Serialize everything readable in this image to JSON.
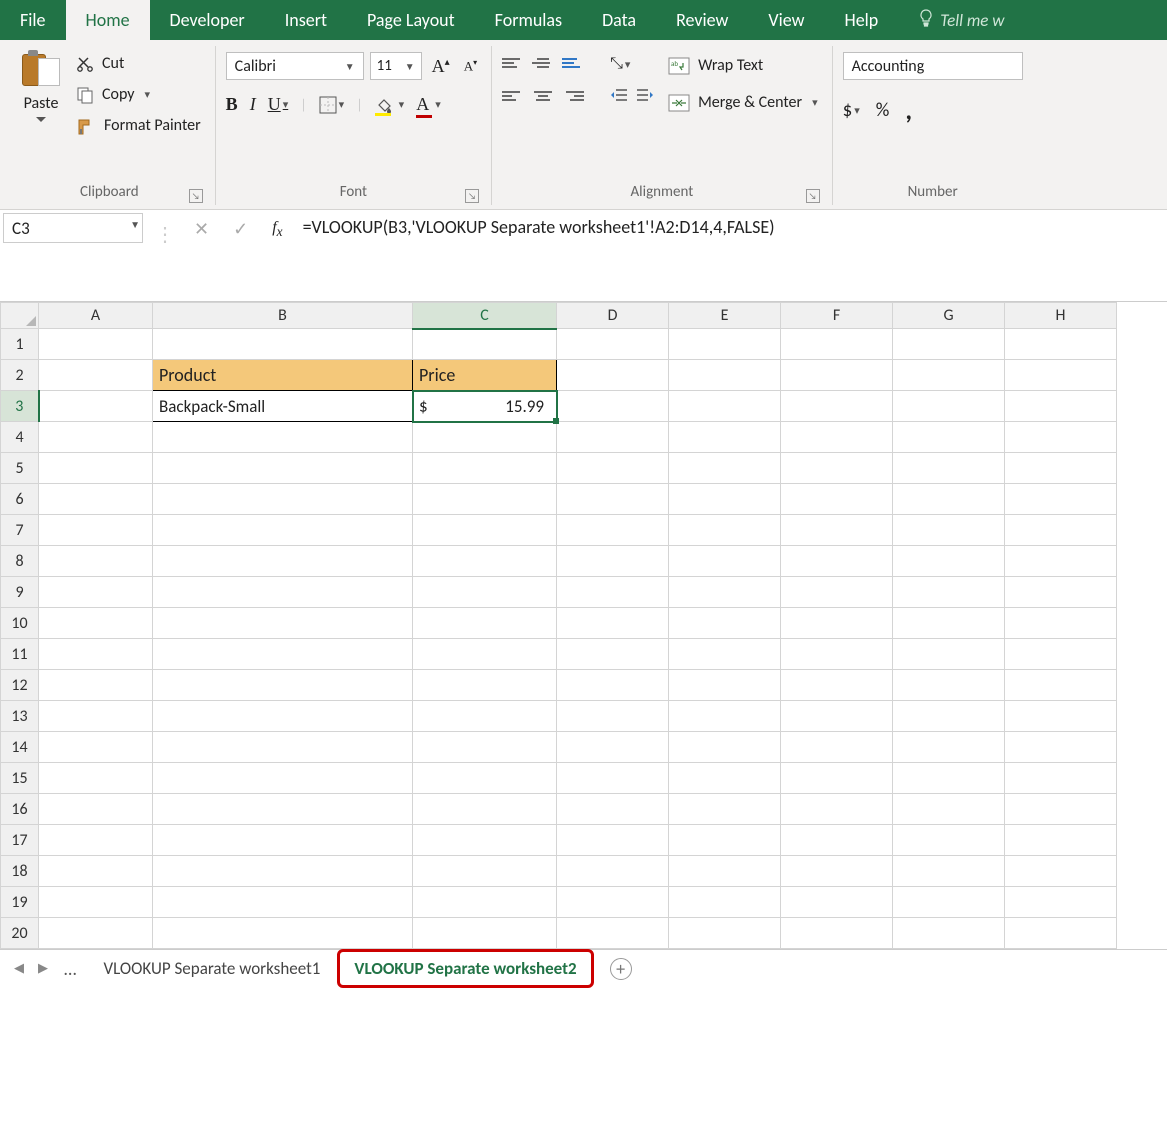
{
  "tabs": {
    "file": "File",
    "home": "Home",
    "developer": "Developer",
    "insert": "Insert",
    "pageLayout": "Page Layout",
    "formulas": "Formulas",
    "data": "Data",
    "review": "Review",
    "view": "View",
    "help": "Help",
    "tellMe": "Tell me w"
  },
  "ribbon": {
    "clipboard": {
      "paste": "Paste",
      "cut": "Cut",
      "copy": "Copy",
      "formatPainter": "Format Painter",
      "groupLabel": "Clipboard"
    },
    "font": {
      "name": "Calibri",
      "size": "11",
      "groupLabel": "Font"
    },
    "alignment": {
      "wrapText": "Wrap Text",
      "mergeCenter": "Merge & Center",
      "groupLabel": "Alignment"
    },
    "number": {
      "format": "Accounting",
      "groupLabel": "Number"
    }
  },
  "nameBox": "C3",
  "formula": "=VLOOKUP(B3,'VLOOKUP Separate worksheet1'!A2:D14,4,FALSE)",
  "columns": [
    "A",
    "B",
    "C",
    "D",
    "E",
    "F",
    "G",
    "H"
  ],
  "rows": [
    "1",
    "2",
    "3",
    "4",
    "5",
    "6",
    "7",
    "8",
    "9",
    "10",
    "11",
    "12",
    "13",
    "14",
    "15",
    "16",
    "17",
    "18",
    "19",
    "20"
  ],
  "selectedCol": "C",
  "selectedRow": "3",
  "sheet": {
    "b2": "Product",
    "c2": "Price",
    "b3": "Backpack-Small",
    "c3_currency": "$",
    "c3_value": "15.99"
  },
  "sheetTabs": {
    "tab1": "VLOOKUP Separate worksheet1",
    "tab2": "VLOOKUP Separate worksheet2"
  }
}
